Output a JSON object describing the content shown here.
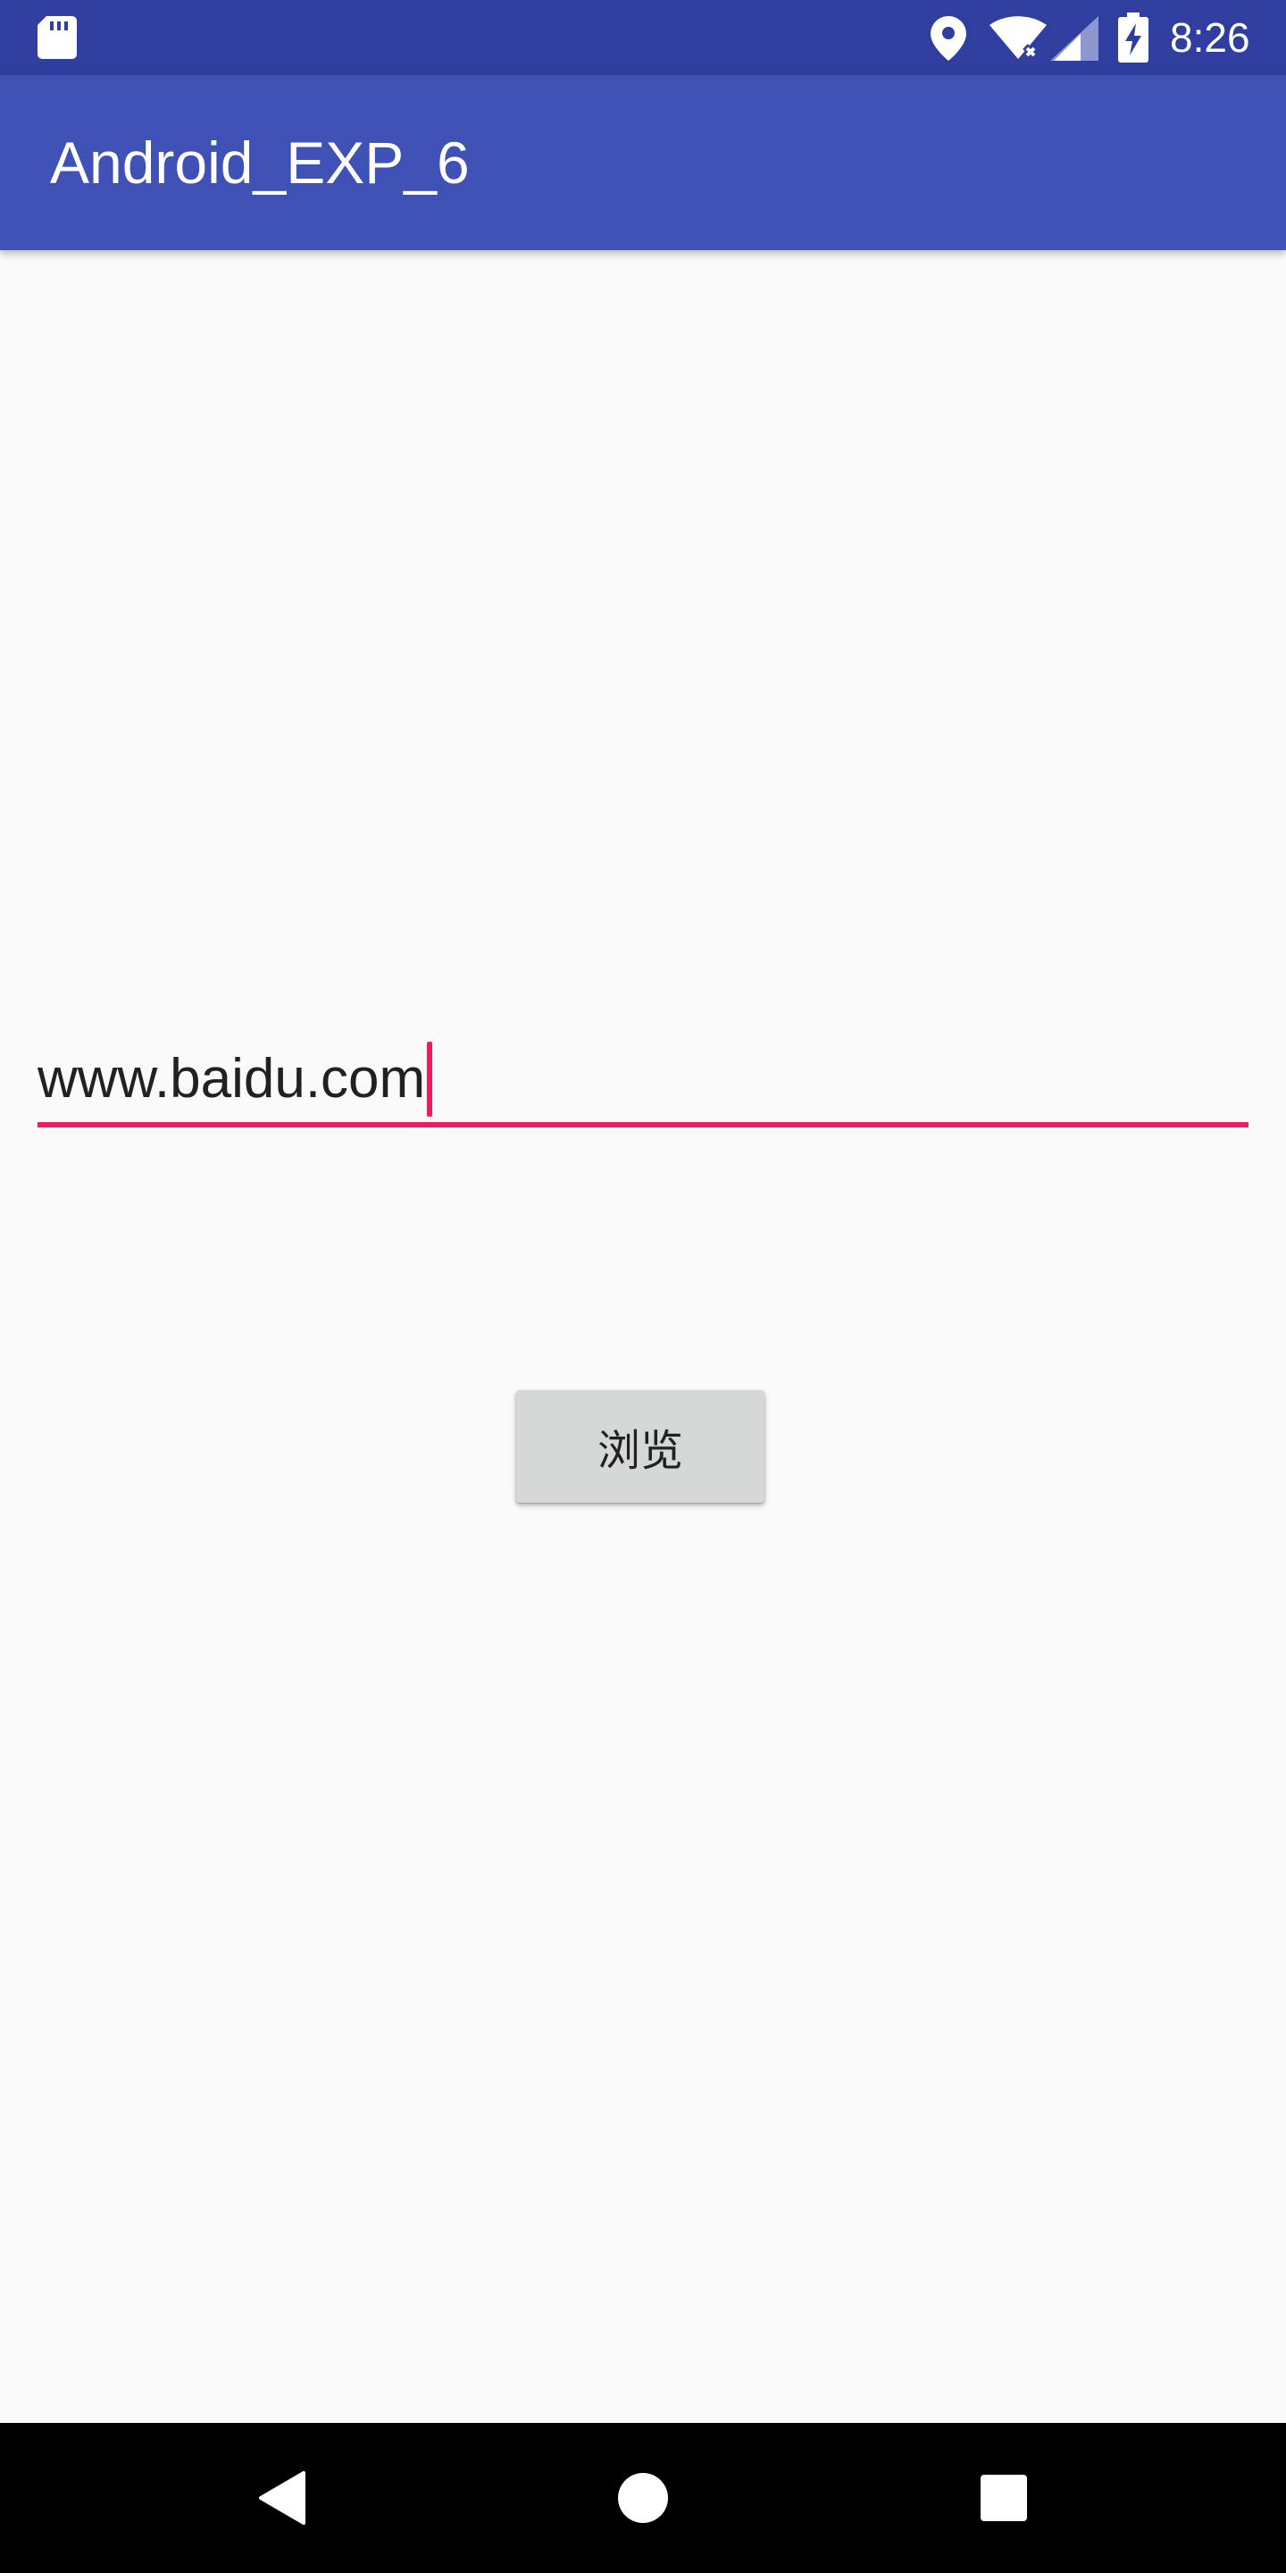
{
  "status_bar": {
    "time": "8:26",
    "background": "#303F9F",
    "icons": [
      "sd-card-icon",
      "location-icon",
      "wifi-icon",
      "signal-icon",
      "battery-charging-icon"
    ]
  },
  "app_bar": {
    "title": "Android_EXP_6",
    "background": "#3F51B5"
  },
  "url_input": {
    "value": "www.baidu.com",
    "accent_color": "#E91E63"
  },
  "browse_button": {
    "label": "浏览"
  },
  "nav_bar": {
    "icons": [
      "back-icon",
      "home-icon",
      "recents-icon"
    ]
  }
}
